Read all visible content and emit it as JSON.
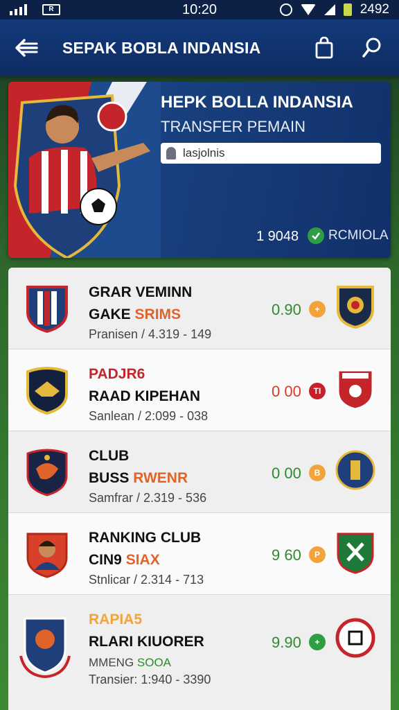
{
  "status_bar": {
    "time": "10:20",
    "battery": "2492",
    "box_label": "R"
  },
  "app_bar": {
    "title": "SEPAK BOBLA INDANSIA",
    "back_icon": "arrow-left-icon",
    "bag_icon": "shopping-bag-icon",
    "search_icon": "search-icon"
  },
  "hero": {
    "title": "HEPK BOLLA INDANSIA",
    "subtitle": "TRANSFER PEMAIN",
    "search_text": "lasjolnis",
    "count": "1 9048",
    "badge_label": "RCMIOLA"
  },
  "colors": {
    "primary": "#0f2c63",
    "accent_green": "#2e8a2e",
    "accent_orange": "#e0642a"
  },
  "rows": [
    {
      "line1": "GRAR VEMINN",
      "line2_a": "GAKE ",
      "line2_b": "SRIMS",
      "line3": "Pranisen / 4.319 - 149",
      "score": "0.90",
      "pill_color": "#f2a43a",
      "pill_glyph": "+"
    },
    {
      "line1": "PADJR6",
      "line2_a": "RAAD K",
      "line2_b": "IPEHAN",
      "line3": "Sanlean / 2:099 - 038",
      "score": "0 00",
      "pill_color": "#c8202a",
      "pill_glyph": "TI"
    },
    {
      "line1": "CLUB",
      "line2_a": "BUSS ",
      "line2_b": "RWENR",
      "line3": "Samfrar / 2.319 - 536",
      "score": "0 00",
      "pill_color": "#f2a43a",
      "pill_glyph": "B"
    },
    {
      "line1": "RANKING CLUB",
      "line2_a": "CIN9 ",
      "line2_b": "SIAX",
      "line3": "Stnlicar / 2.314 - 713",
      "score": "9 60",
      "pill_color": "#f2a43a",
      "pill_glyph": "P"
    },
    {
      "line1": "RAPIA5",
      "line2_a": "RLARI KIUORER",
      "line2_b": "",
      "line3a": "MMENG ",
      "line3b": "SOOA",
      "line4": "Transier: 1:940 - 3390",
      "score": "9.90",
      "pill_color": "#2e9d43",
      "pill_glyph": "+"
    }
  ]
}
